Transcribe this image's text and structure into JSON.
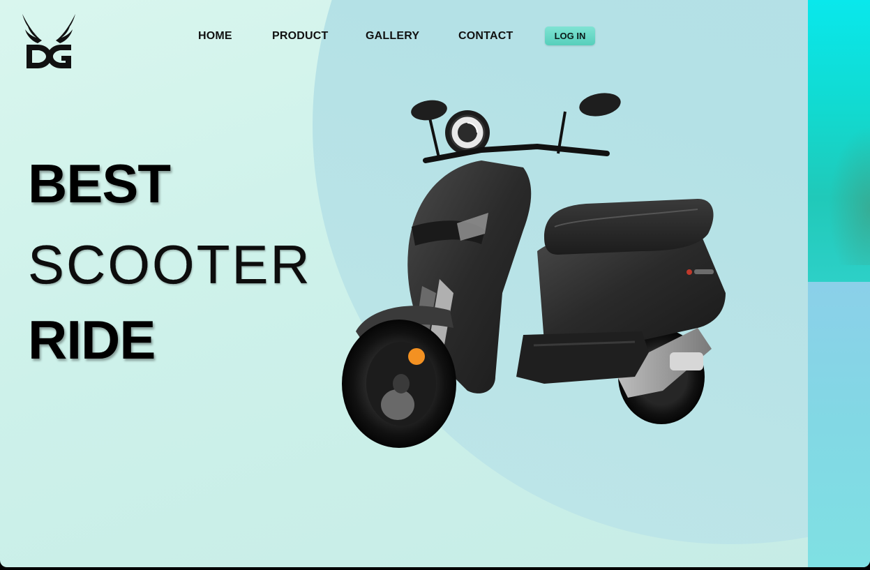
{
  "nav": {
    "items": [
      {
        "label": "HOME"
      },
      {
        "label": "PRODUCT"
      },
      {
        "label": "GALLERY"
      },
      {
        "label": "CONTACT"
      }
    ],
    "login_label": "LOG IN"
  },
  "hero": {
    "line1": "BEST",
    "line2": "SCOOTER",
    "line3": "RIDE"
  },
  "colors": {
    "background": "#d3f4ec",
    "circle": "#b4e0e6",
    "accent_cyan": "#09e8ec",
    "login_button": "#6ad9c6",
    "scooter_body": "#2b2b2b",
    "reflector": "#f39122"
  },
  "icons": {
    "logo": "winged-dg-logo",
    "product_image": "electric-scooter"
  }
}
